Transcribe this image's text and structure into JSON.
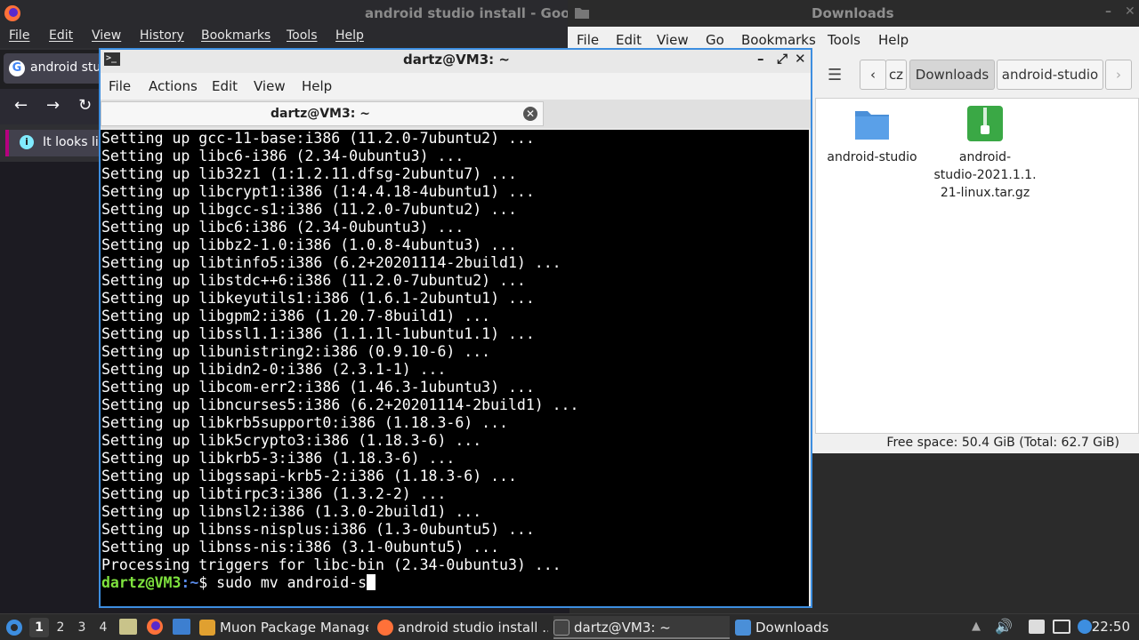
{
  "firefox": {
    "title": "android studio install - Goo",
    "menu": [
      "File",
      "Edit",
      "View",
      "History",
      "Bookmarks",
      "Tools",
      "Help"
    ],
    "tab_label": "android stud",
    "info_text": "It looks lik"
  },
  "file_manager": {
    "title": "Downloads",
    "menu": [
      "File",
      "Edit",
      "View",
      "Go",
      "Bookmarks",
      "Tools",
      "Help"
    ],
    "path": [
      "cz",
      "Downloads",
      "android-studio"
    ],
    "items": [
      {
        "name": "android-studio",
        "icon": "folder-icon",
        "color": "#4a8fd8"
      },
      {
        "name": "android-studio-2021.1.1.21-linux.tar.gz",
        "icon": "archive-icon",
        "color": "#3aa845",
        "label_lines": [
          "android-",
          "studio-2021.1.1.",
          "21-linux.tar.gz"
        ]
      }
    ],
    "status": "Free space: 50.4 GiB (Total: 62.7 GiB)"
  },
  "terminal": {
    "title": "dartz@VM3: ~",
    "menu": [
      "File",
      "Actions",
      "Edit",
      "View",
      "Help"
    ],
    "tab_label": "dartz@VM3: ~",
    "lines": [
      "Setting up gcc-11-base:i386 (11.2.0-7ubuntu2) ...",
      "Setting up libc6-i386 (2.34-0ubuntu3) ...",
      "Setting up lib32z1 (1:1.2.11.dfsg-2ubuntu7) ...",
      "Setting up libcrypt1:i386 (1:4.4.18-4ubuntu1) ...",
      "Setting up libgcc-s1:i386 (11.2.0-7ubuntu2) ...",
      "Setting up libc6:i386 (2.34-0ubuntu3) ...",
      "Setting up libbz2-1.0:i386 (1.0.8-4ubuntu3) ...",
      "Setting up libtinfo5:i386 (6.2+20201114-2build1) ...",
      "Setting up libstdc++6:i386 (11.2.0-7ubuntu2) ...",
      "Setting up libkeyutils1:i386 (1.6.1-2ubuntu1) ...",
      "Setting up libgpm2:i386 (1.20.7-8build1) ...",
      "Setting up libssl1.1:i386 (1.1.1l-1ubuntu1.1) ...",
      "Setting up libunistring2:i386 (0.9.10-6) ...",
      "Setting up libidn2-0:i386 (2.3.1-1) ...",
      "Setting up libcom-err2:i386 (1.46.3-1ubuntu3) ...",
      "Setting up libncurses5:i386 (6.2+20201114-2build1) ...",
      "Setting up libkrb5support0:i386 (1.18.3-6) ...",
      "Setting up libk5crypto3:i386 (1.18.3-6) ...",
      "Setting up libkrb5-3:i386 (1.18.3-6) ...",
      "Setting up libgssapi-krb5-2:i386 (1.18.3-6) ...",
      "Setting up libtirpc3:i386 (1.3.2-2) ...",
      "Setting up libnsl2:i386 (1.3.0-2build1) ...",
      "Setting up libnss-nisplus:i386 (1.3-0ubuntu5) ...",
      "Setting up libnss-nis:i386 (3.1-0ubuntu5) ...",
      "Processing triggers for libc-bin (2.34-0ubuntu3) ..."
    ],
    "prompt_user": "dartz@VM3",
    "prompt_path": ":~",
    "prompt_symbol": "$ ",
    "command": "sudo mv android-s"
  },
  "taskbar": {
    "workspaces": [
      "1",
      "2",
      "3",
      "4"
    ],
    "tasks": [
      {
        "label": "Muon Package Manager",
        "icon": "package-icon",
        "color": "#e0a030"
      },
      {
        "label": "android studio install ...",
        "icon": "firefox-icon",
        "color": "#ff7139"
      },
      {
        "label": "dartz@VM3: ~",
        "icon": "terminal-icon",
        "color": "#444444"
      },
      {
        "label": "Downloads",
        "icon": "folder-icon",
        "color": "#4a8fd8"
      }
    ],
    "clock": "22:50"
  },
  "colors": {
    "accent": "#3d8ee0",
    "prompt_user": "#7ee23e",
    "prompt_path": "#5a8bea"
  }
}
